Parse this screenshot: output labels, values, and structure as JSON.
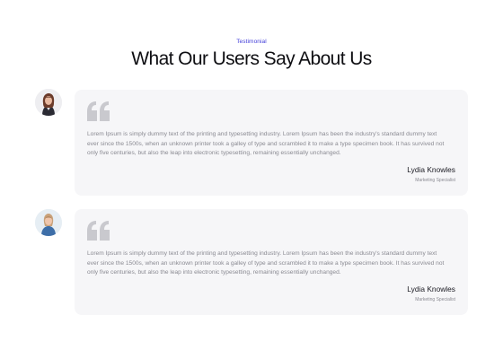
{
  "section": {
    "eyebrow": "Testimonial",
    "title": "What Our Users Say About Us"
  },
  "testimonials": [
    {
      "text": "Lorem Ipsum is simply dummy text of the printing and typesetting industry. Lorem Ipsum has been the industry's standard dummy text ever since the 1500s, when an unknown printer took a galley of type and scrambled it to make a type specimen book. It has survived not only five centuries, but also the leap into electronic typesetting, remaining essentially unchanged.",
      "name": "Lydia Knowles",
      "role": "Marketing Specialist",
      "avatar_icon": "woman-portrait-avatar"
    },
    {
      "text": "Lorem Ipsum is simply dummy text of the printing and typesetting industry. Lorem Ipsum has been the industry's standard dummy text ever since the 1500s, when an unknown printer took a galley of type and scrambled it to make a type specimen book. It has survived not only five centuries, but also the leap into electronic typesetting, remaining essentially unchanged.",
      "name": "Lydia Knowles",
      "role": "Marketing Specialist",
      "avatar_icon": "woman-portrait-avatar"
    }
  ],
  "colors": {
    "accent": "#3f3bd8",
    "card_bg": "#f6f6f8",
    "quote_icon": "#c9c9ce",
    "body_text": "#8a8a92"
  }
}
